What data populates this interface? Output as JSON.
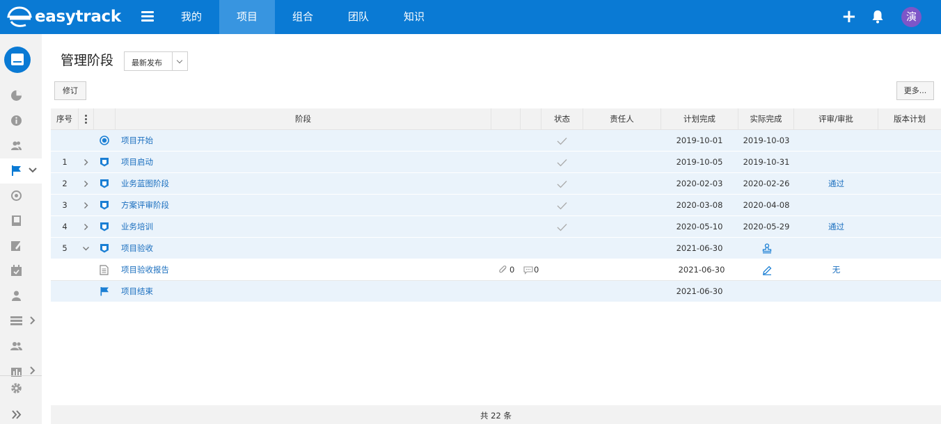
{
  "app": {
    "brand": "easytrack"
  },
  "nav": {
    "items": [
      "我的",
      "项目",
      "组合",
      "团队",
      "知识"
    ],
    "active_index": 1
  },
  "user": {
    "avatar_text": "演",
    "avatar_color": "#7d56c8"
  },
  "page": {
    "title": "管理阶段",
    "version_select": "最新发布",
    "revise_button": "修订",
    "more_button": "更多..."
  },
  "table": {
    "headers": {
      "no": "序号",
      "stage": "阶段",
      "status": "状态",
      "owner": "责任人",
      "plan_finish": "计划完成",
      "actual_finish": "实际完成",
      "review": "评审/审批",
      "version_plan": "版本计划"
    },
    "rows": [
      {
        "no": "",
        "name": "项目开始",
        "icon": "milestone-circle-icon",
        "expandable": false,
        "status_done": true,
        "plan": "2019-10-01",
        "actual": "2019-10-03",
        "review": ""
      },
      {
        "no": "1",
        "name": "项目启动",
        "icon": "stage-shield-icon",
        "expandable": true,
        "status_done": true,
        "plan": "2019-10-05",
        "actual": "2019-10-31",
        "review": ""
      },
      {
        "no": "2",
        "name": "业务蓝图阶段",
        "icon": "stage-shield-icon",
        "expandable": true,
        "status_done": true,
        "plan": "2020-02-03",
        "actual": "2020-02-26",
        "review": "通过"
      },
      {
        "no": "3",
        "name": "方案评审阶段",
        "icon": "stage-shield-icon",
        "expandable": true,
        "status_done": true,
        "plan": "2020-03-08",
        "actual": "2020-04-08",
        "review": ""
      },
      {
        "no": "4",
        "name": "业务培训",
        "icon": "stage-shield-icon",
        "expandable": true,
        "status_done": true,
        "plan": "2020-05-10",
        "actual": "2020-05-29",
        "review": "通过"
      },
      {
        "no": "5",
        "name": "项目验收",
        "icon": "stage-shield-icon",
        "expandable": true,
        "expanded": true,
        "status_done": false,
        "plan": "2021-06-30",
        "actual_icon": "stamp-icon",
        "review": ""
      },
      {
        "no": "",
        "name": "项目验收报告",
        "icon": "document-icon",
        "expandable": false,
        "attachments": "0",
        "comments": "0",
        "plan": "2021-06-30",
        "actual_icon": "edit-icon",
        "review": "无"
      },
      {
        "no": "",
        "name": "项目结束",
        "icon": "flag-icon",
        "expandable": false,
        "status_done": false,
        "plan": "2021-06-30",
        "actual": "",
        "review": ""
      }
    ]
  },
  "footer": {
    "total": "共 22 条"
  },
  "colors": {
    "primary": "#0a7ad4",
    "nav_active": "#3895e0",
    "link": "#1b6fbf",
    "row_shade": "#eaf3fb"
  }
}
